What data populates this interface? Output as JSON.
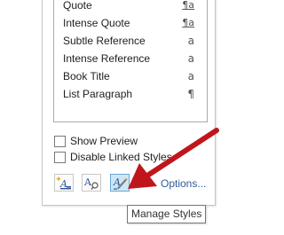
{
  "styles": [
    {
      "name": "Quote",
      "glyph": "¶a",
      "kind": "linked"
    },
    {
      "name": "Intense Quote",
      "glyph": "¶a",
      "kind": "linked"
    },
    {
      "name": "Subtle Reference",
      "glyph": "a",
      "kind": "character"
    },
    {
      "name": "Intense Reference",
      "glyph": "a",
      "kind": "character"
    },
    {
      "name": "Book Title",
      "glyph": "a",
      "kind": "character"
    },
    {
      "name": "List Paragraph",
      "glyph": "¶",
      "kind": "paragraph"
    }
  ],
  "options": {
    "show_preview": "Show Preview",
    "show_preview_checked": false,
    "disable_linked_styles": "Disable Linked Styles",
    "disable_linked_styles_checked": false
  },
  "buttons": {
    "new_style_icon": "new-style-icon",
    "style_inspector_icon": "style-inspector-icon",
    "manage_styles_icon": "manage-styles-icon",
    "options_link": "Options..."
  },
  "tooltip": {
    "text": "Manage Styles"
  },
  "colors": {
    "arrow": "#c0161b",
    "link": "#2e5b9a",
    "active_button": "#cde6f7"
  }
}
